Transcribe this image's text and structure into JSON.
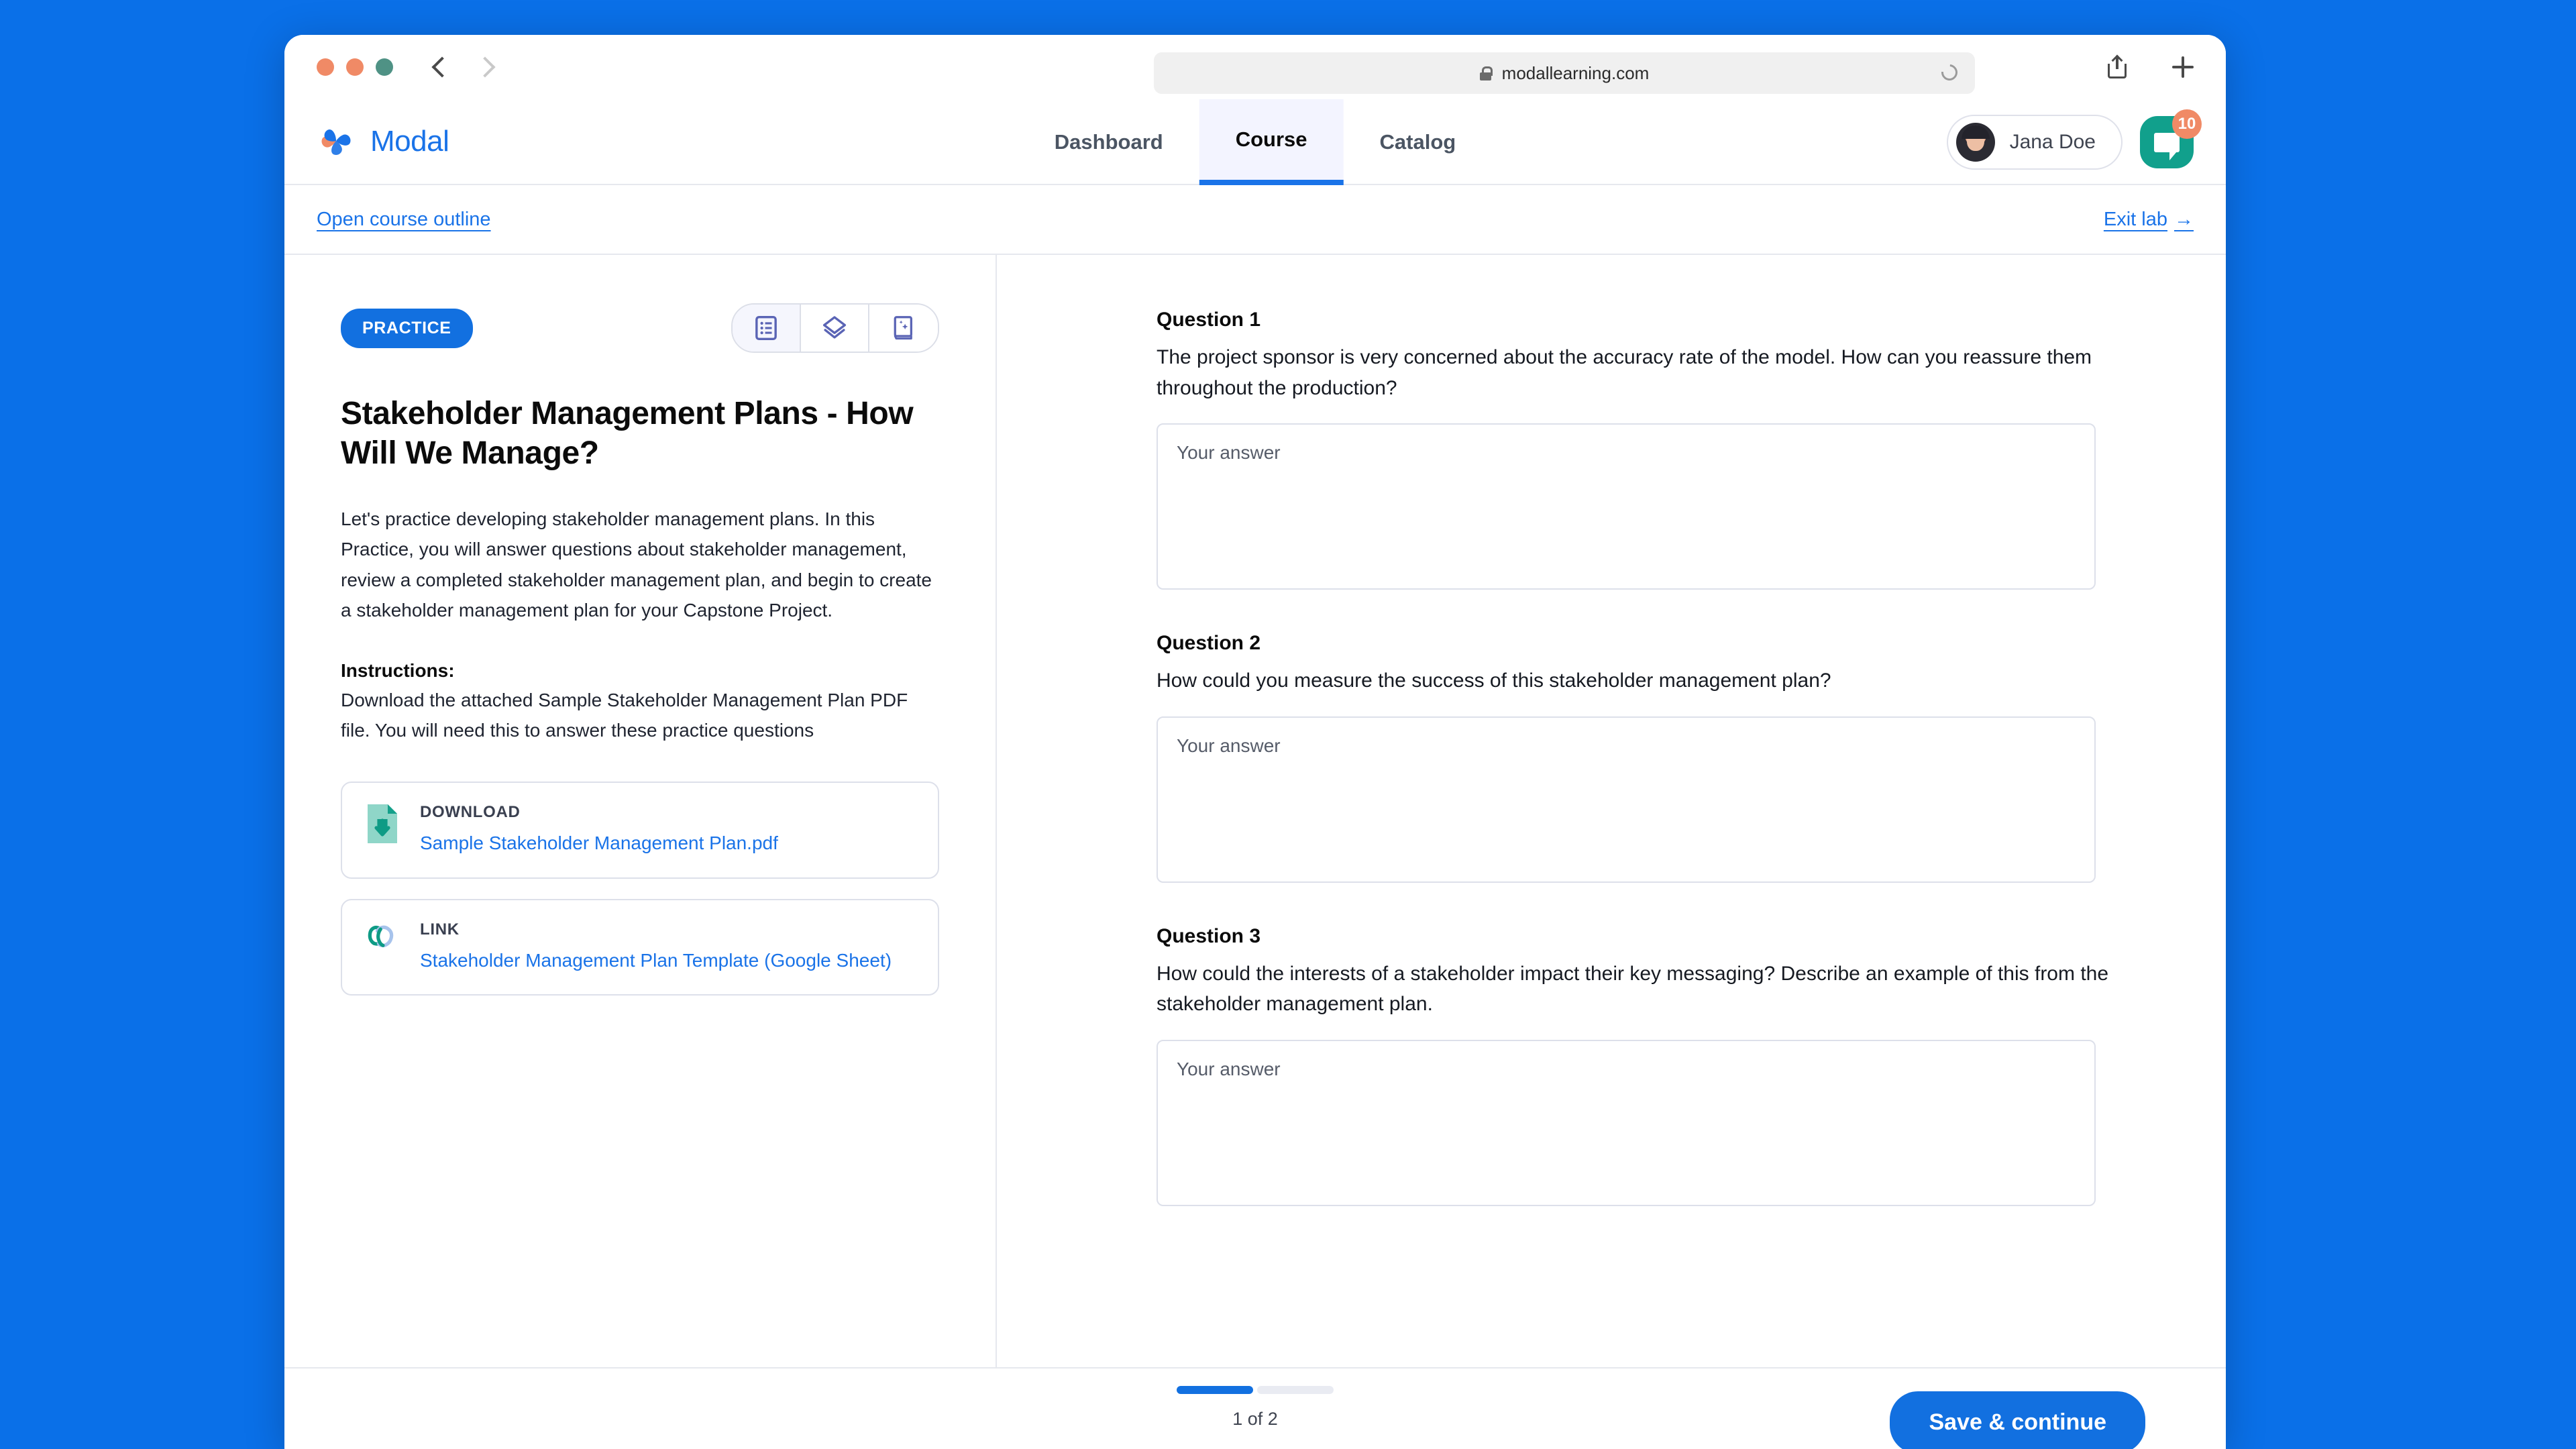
{
  "browser": {
    "url": "modallearning.com",
    "lock_icon": "lock-icon",
    "reload_icon": "reload-icon",
    "back_icon": "chevron-left-icon",
    "forward_icon": "chevron-right-icon",
    "share_icon": "share-icon",
    "new_tab_icon": "plus-icon"
  },
  "header": {
    "brand": "Modal",
    "logo_icon": "modal-flower-logo-icon",
    "tabs": [
      {
        "label": "Dashboard",
        "active": false
      },
      {
        "label": "Course",
        "active": true
      },
      {
        "label": "Catalog",
        "active": false
      }
    ],
    "user": {
      "name": "Jana Doe",
      "avatar_icon": "avatar"
    },
    "chat": {
      "icon": "chat-bubble-icon",
      "badge": "10"
    }
  },
  "sub_bar": {
    "outline_link": "Open course outline",
    "exit_link": "Exit lab",
    "exit_arrow": "→"
  },
  "left_pane": {
    "badge": "PRACTICE",
    "view_icons": [
      {
        "name": "document-list-icon",
        "active": true
      },
      {
        "name": "layers-icon",
        "active": false
      },
      {
        "name": "flashcard-book-icon",
        "active": false
      }
    ],
    "title": "Stakeholder Management Plans - How Will We Manage?",
    "description": "Let's practice developing stakeholder management plans. In this Practice, you will answer questions about stakeholder management, review a completed stakeholder management plan, and begin to create a stakeholder management plan for your Capstone Project.",
    "instructions_label": "Instructions:",
    "instructions_text": "Download the attached Sample Stakeholder Management Plan PDF file. You will need this to answer these practice questions",
    "resources": [
      {
        "type": "DOWNLOAD",
        "icon": "file-download-icon",
        "link": "Sample Stakeholder Management Plan.pdf"
      },
      {
        "type": "LINK",
        "icon": "chain-link-icon",
        "link": "Stakeholder Management Plan Template (Google Sheet)"
      }
    ]
  },
  "right_pane": {
    "questions": [
      {
        "title": "Question 1",
        "text": "The project sponsor is very concerned about the accuracy rate of the model. How can you reassure them throughout the production?",
        "placeholder": "Your answer",
        "value": ""
      },
      {
        "title": "Question 2",
        "text": "How could you measure the success of this stakeholder management plan?",
        "placeholder": "Your answer",
        "value": ""
      },
      {
        "title": "Question 3",
        "text": "How could the interests of a stakeholder impact their key messaging? Describe an example of this from the stakeholder management plan.",
        "placeholder": "Your answer",
        "value": ""
      }
    ]
  },
  "footer": {
    "page_count": "1 of 2",
    "segments_total": 2,
    "segments_done": 1,
    "save_label": "Save & continue"
  },
  "colors": {
    "brand_blue": "#1270e0",
    "accent_orange": "#f08a66",
    "teal": "#11a08c",
    "page_bg": "#0a70e8"
  }
}
